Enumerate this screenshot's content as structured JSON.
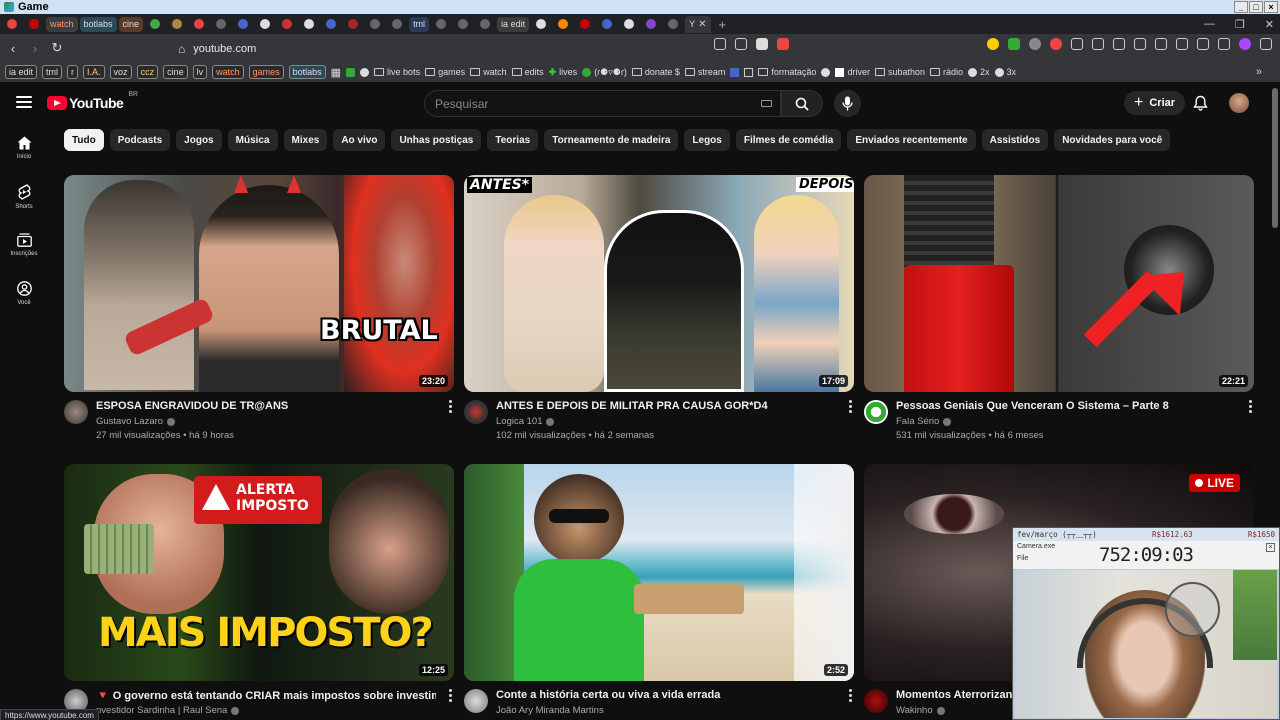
{
  "os": {
    "window_title": "Game"
  },
  "tabs": {
    "named": [
      "watch",
      "botlabs",
      "cine",
      "tml",
      "ia edit"
    ],
    "active_letter": "Y",
    "close_glyph": "✕",
    "new_tab_glyph": "+"
  },
  "address_bar": {
    "url": "youtube.com"
  },
  "bookmarks": {
    "chips": [
      "ia edit",
      "tml",
      "r",
      "I.A.",
      "voz",
      "ccz",
      "cine",
      "lv",
      "watch",
      "games",
      "botlabs"
    ],
    "items": [
      "live bots",
      "games",
      "watch",
      "edits",
      "lives",
      "(ɾ⚈▿⚈ɾ)",
      "donate $",
      "stream",
      "formatação",
      "driver",
      "subathon",
      "rádio",
      "2x",
      "3x"
    ],
    "more": "»"
  },
  "youtube": {
    "logo_text": "YouTube",
    "region": "BR",
    "search_placeholder": "Pesquisar",
    "create_label": "Criar",
    "sidebar": [
      {
        "label": "Início",
        "icon": "home-icon"
      },
      {
        "label": "Shorts",
        "icon": "shorts-icon"
      },
      {
        "label": "Inscrições",
        "icon": "subscriptions-icon"
      },
      {
        "label": "Você",
        "icon": "you-icon"
      }
    ],
    "chips": [
      "Tudo",
      "Podcasts",
      "Jogos",
      "Música",
      "Mixes",
      "Ao vivo",
      "Unhas postiças",
      "Teorias",
      "Torneamento de madeira",
      "Legos",
      "Filmes de comédia",
      "Enviados recentemente",
      "Assistidos",
      "Novidades para você"
    ],
    "active_chip": "Tudo",
    "videos": [
      {
        "title": "ESPOSA ENGRAVIDOU DE TR@ANS",
        "channel": "Gustavo Lazaro",
        "stats": "27 mil visualizações • há 9 horas",
        "duration": "23:20",
        "overlay": "BRUTAL"
      },
      {
        "title": "ANTES E DEPOIS DE MILITAR PRA CAUSA GOR*D4",
        "channel": "Logica 101",
        "stats": "102 mil visualizações • há 2 semanas",
        "duration": "17:09",
        "overlay_left": "ANTES*",
        "overlay_right": "DEPOIS*"
      },
      {
        "title": "Pessoas Geniais Que Venceram O Sistema – Parte 8",
        "channel": "Fala Sério",
        "stats": "531 mil visualizações • há 6 meses",
        "duration": "22:21"
      },
      {
        "title": "O governo está tentando CRIAR mais impostos sobre investimentos",
        "channel": "nvestidor Sardinha | Raul Sena",
        "stats": "",
        "duration": "12:25",
        "overlay_top": "ALERTA IMPOSTO",
        "overlay": "MAIS IMPOSTO?",
        "title_badge": "🔻"
      },
      {
        "title": "Conte a história certa ou viva a vida errada",
        "channel": "João Ary Miranda Martins",
        "stats": "",
        "duration": "2:52"
      },
      {
        "title": "Momentos Aterrorizantes",
        "channel": "Wakinho",
        "stats": "",
        "live_label": "LIVE"
      }
    ]
  },
  "status_bar": {
    "text": "https://www.youtube.com"
  },
  "camera_widget": {
    "goal_label": "fev/março",
    "goal_emote": "(┬┬﹏┬┬)",
    "goal_value": "R$1612.63",
    "goal_target": "R$1650",
    "window_title": "Camera.exe",
    "menu": "File",
    "timer": "752:09:03"
  },
  "colors": {
    "brand_red": "#ff0033",
    "background": "#0f0f0f",
    "chip_bg": "#272727",
    "live_red": "#cc0000"
  }
}
